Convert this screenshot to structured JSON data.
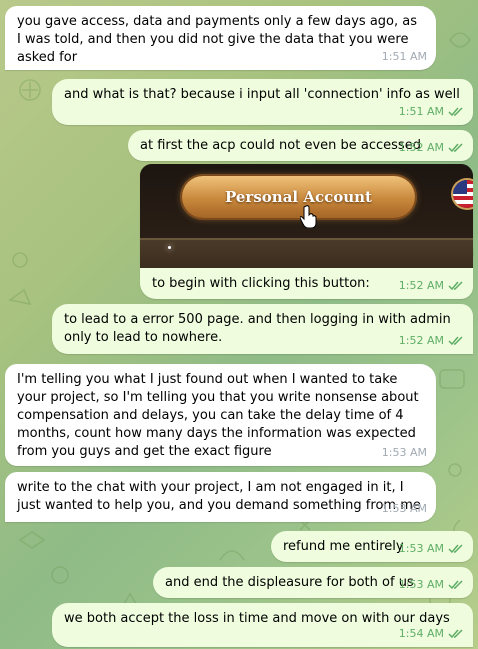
{
  "messages": [
    {
      "dir": "in",
      "text": "you gave access, data and payments only a few days ago, as I was told, and then you did not give the data that you were asked for",
      "time": "1:51 AM"
    },
    {
      "dir": "out",
      "text": "and what is that? because i input all 'connection' info as well",
      "time": "1:51 AM"
    },
    {
      "dir": "out",
      "text": "at first the acp could not even be accessed",
      "time": "1:52 AM"
    },
    {
      "dir": "out",
      "text": "to begin with clicking this button:",
      "time": "1:52 AM",
      "image_button_label": "Personal Account"
    },
    {
      "dir": "out",
      "text": "to lead to a error 500 page. and then logging in with admin only to lead to nowhere.",
      "time": "1:52 AM"
    },
    {
      "dir": "in",
      "text": "I'm telling you what I just found out when I wanted to take your project, so I'm telling you that you write nonsense about compensation and delays, you can take the delay time of 4 months, count how many days the information was expected from you guys and get the exact figure",
      "time": "1:53 AM"
    },
    {
      "dir": "in",
      "text": "write to the chat with your project, I am not engaged in it, I just wanted to help you, and you demand something from me",
      "time": "1:53 AM"
    },
    {
      "dir": "out",
      "text": "refund me entirely",
      "time": "1:53 AM"
    },
    {
      "dir": "out",
      "text": "and end the displeasure for both of us",
      "time": "1:53 AM"
    },
    {
      "dir": "out",
      "text": "we both accept the loss in time and move on with our days",
      "time": "1:54 AM"
    }
  ],
  "colors": {
    "incoming": "#ffffff",
    "outgoing": "#effdde",
    "checks": "#5fad66",
    "time_in": "#a1aab3"
  }
}
